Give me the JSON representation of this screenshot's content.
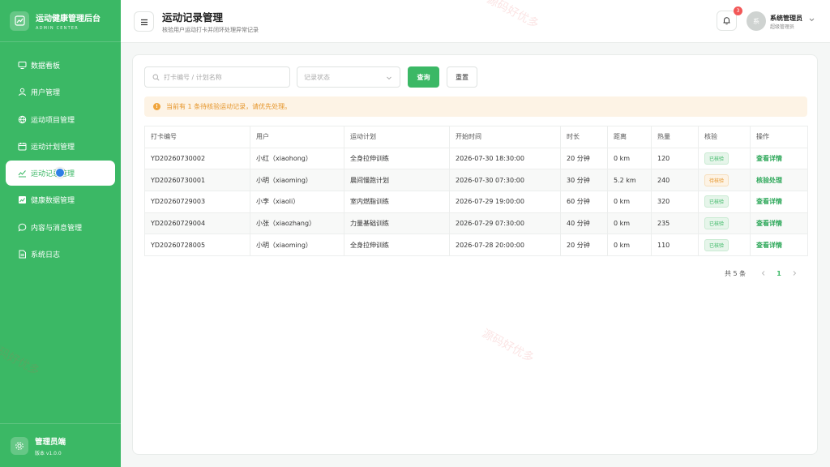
{
  "brand": {
    "title": "运动健康管理后台",
    "subtitle": "ADMIN CENTER"
  },
  "sidebar": {
    "items": [
      {
        "label": "数据看板",
        "icon": "monitor-icon"
      },
      {
        "label": "用户管理",
        "icon": "user-icon"
      },
      {
        "label": "运动项目管理",
        "icon": "ball-icon"
      },
      {
        "label": "运动计划管理",
        "icon": "calendar-icon"
      },
      {
        "label": "运动记录管理",
        "icon": "record-icon",
        "active": true
      },
      {
        "label": "健康数据管理",
        "icon": "chart-icon"
      },
      {
        "label": "内容与消息管理",
        "icon": "chat-icon"
      },
      {
        "label": "系统日志",
        "icon": "document-icon"
      }
    ],
    "footer": {
      "title": "管理员端",
      "version": "版本 v1.0.0"
    }
  },
  "header": {
    "title": "运动记录管理",
    "subtitle": "核验用户运动打卡并闭环处理异常记录",
    "notification_count": "3",
    "user": {
      "avatar_char": "系",
      "name": "系统管理员",
      "role": "超级管理员"
    }
  },
  "filters": {
    "search_placeholder": "打卡编号 / 计划名称",
    "status_placeholder": "记录状态",
    "query_label": "查询",
    "reset_label": "重置"
  },
  "alert": {
    "text": "当前有 1 条待核验运动记录，请优先处理。"
  },
  "table": {
    "columns": [
      "打卡编号",
      "用户",
      "运动计划",
      "开始时间",
      "时长",
      "距离",
      "热量",
      "核验",
      "操作"
    ],
    "rows": [
      {
        "id": "YD20260730002",
        "user": "小红（xiaohong）",
        "plan": "全身拉伸训练",
        "start": "2026-07-30 18:30:00",
        "duration": "20 分钟",
        "distance": "0 km",
        "calories": "120",
        "status": "已核验",
        "status_type": "ok",
        "action": "查看详情"
      },
      {
        "id": "YD20260730001",
        "user": "小明（xiaoming）",
        "plan": "晨间慢跑计划",
        "start": "2026-07-30 07:30:00",
        "duration": "30 分钟",
        "distance": "5.2 km",
        "calories": "240",
        "status": "待核验",
        "status_type": "pending",
        "action": "核验处理"
      },
      {
        "id": "YD20260729003",
        "user": "小李（xiaoli）",
        "plan": "室内燃脂训练",
        "start": "2026-07-29 19:00:00",
        "duration": "60 分钟",
        "distance": "0 km",
        "calories": "320",
        "status": "已核验",
        "status_type": "ok",
        "action": "查看详情"
      },
      {
        "id": "YD20260729004",
        "user": "小张（xiaozhang）",
        "plan": "力量基础训练",
        "start": "2026-07-29 07:30:00",
        "duration": "40 分钟",
        "distance": "0 km",
        "calories": "235",
        "status": "已核验",
        "status_type": "ok",
        "action": "查看详情"
      },
      {
        "id": "YD20260728005",
        "user": "小明（xiaoming）",
        "plan": "全身拉伸训练",
        "start": "2026-07-28 20:00:00",
        "duration": "20 分钟",
        "distance": "0 km",
        "calories": "110",
        "status": "已核验",
        "status_type": "ok",
        "action": "查看详情"
      }
    ]
  },
  "pagination": {
    "total_text": "共 5 条",
    "current_page": "1"
  },
  "watermark": {
    "text": "源码好优多"
  },
  "colors": {
    "brand": "#3bb865",
    "warning": "#e5952a",
    "danger": "#f25757"
  }
}
